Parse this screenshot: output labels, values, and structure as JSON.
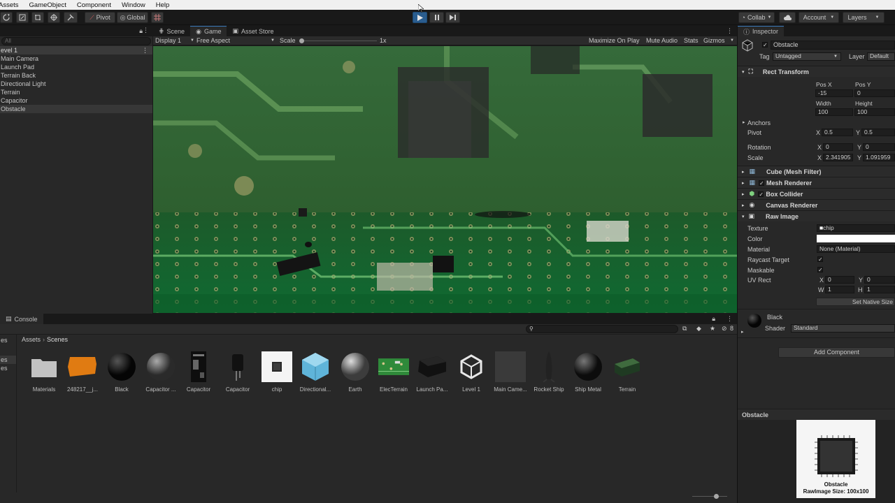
{
  "menu": [
    "Assets",
    "GameObject",
    "Component",
    "Window",
    "Help"
  ],
  "toolbar": {
    "pivot": "Pivot",
    "global": "Global",
    "collab": "Collab",
    "account": "Account",
    "layers": "Layers"
  },
  "hierarchy": {
    "header": "evel 1",
    "items": [
      "Main Camera",
      "Launch Pad",
      "Terrain Back",
      "Directional Light",
      "Terrain",
      "Capacitor",
      "Obstacle"
    ],
    "search_placeholder": "All"
  },
  "view_tabs": {
    "scene": "Scene",
    "game": "Game",
    "asset_store": "Asset Store",
    "display": "Display 1",
    "aspect": "Free Aspect",
    "scale_label": "Scale",
    "scale_value": "1x",
    "maximize": "Maximize On Play",
    "mute": "Mute Audio",
    "stats": "Stats",
    "gizmos": "Gizmos"
  },
  "console": {
    "tab": "Console",
    "hidden_count": "8"
  },
  "project": {
    "left_labels": [
      "es",
      "es",
      "es"
    ],
    "breadcrumb": [
      "Assets",
      "Scenes"
    ],
    "assets": [
      {
        "name": "Materials",
        "icon": "folder-icon"
      },
      {
        "name": "248217__j...",
        "icon": "texture-orange-icon"
      },
      {
        "name": "Black",
        "icon": "material-sphere-black-icon"
      },
      {
        "name": "Capacitor ...",
        "icon": "material-sphere-grey-icon"
      },
      {
        "name": "Capacitor",
        "icon": "capacitor-texture-icon"
      },
      {
        "name": "Capacitor",
        "icon": "capacitor-model-icon"
      },
      {
        "name": "chip",
        "icon": "chip-texture-icon"
      },
      {
        "name": "Directional...",
        "icon": "prefab-cube-icon"
      },
      {
        "name": "Earth",
        "icon": "material-sphere-light-icon"
      },
      {
        "name": "ElecTerrain",
        "icon": "circuit-texture-icon"
      },
      {
        "name": "Launch Pa...",
        "icon": "launch-pad-model-icon"
      },
      {
        "name": "Level 1",
        "icon": "unity-scene-icon"
      },
      {
        "name": "Main Came...",
        "icon": "empty-prefab-icon"
      },
      {
        "name": "Rocket Ship",
        "icon": "rocket-model-icon"
      },
      {
        "name": "Ship Metal",
        "icon": "material-sphere-dark-icon"
      },
      {
        "name": "Terrain",
        "icon": "terrain-model-icon"
      }
    ]
  },
  "inspector": {
    "tab": "Inspector",
    "object_name": "Obstacle",
    "tag_label": "Tag",
    "tag_value": "Untagged",
    "layer_label": "Layer",
    "layer_value": "Default",
    "rect_transform": {
      "title": "Rect Transform",
      "pos_x_label": "Pos X",
      "pos_y_label": "Pos Y",
      "pos_x": "-15",
      "pos_y": "0",
      "width_label": "Width",
      "height_label": "Height",
      "width": "100",
      "height": "100",
      "anchors": "Anchors",
      "pivot_label": "Pivot",
      "pivot_x": "0.5",
      "pivot_y": "0.5",
      "rotation_label": "Rotation",
      "rotation_x": "0",
      "rotation_y": "0",
      "scale_label": "Scale",
      "scale_x": "2.341905",
      "scale_y": "1.091959"
    },
    "components": [
      "Cube (Mesh Filter)",
      "Mesh Renderer",
      "Box Collider",
      "Canvas Renderer",
      "Raw Image"
    ],
    "raw_image": {
      "texture_label": "Texture",
      "texture_value": "chip",
      "color_label": "Color",
      "material_label": "Material",
      "material_value": "None (Material)",
      "raycast_label": "Raycast Target",
      "maskable_label": "Maskable",
      "uvrect_label": "UV Rect",
      "uv_x": "0",
      "uv_y": "0",
      "uv_w": "1",
      "uv_h": "1",
      "native_size": "Set Native Size"
    },
    "material": {
      "name": "Black",
      "shader_label": "Shader",
      "shader_value": "Standard"
    },
    "add_component": "Add Component",
    "preview_title": "Obstacle",
    "preview_caption_1": "Obstacle",
    "preview_caption_2": "RawImage Size: 100x100",
    "xy": {
      "x": "X",
      "y": "Y",
      "w": "W",
      "h": "H"
    }
  },
  "colors": {
    "accent": "#3a79bb",
    "play_active": "#2a5d8f"
  }
}
